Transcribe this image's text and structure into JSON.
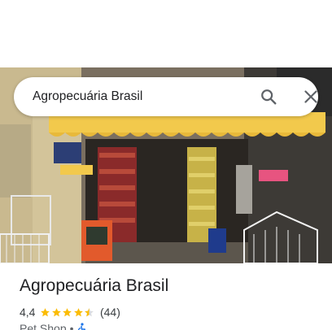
{
  "search": {
    "value": "Agropecuária Brasil"
  },
  "place": {
    "name": "Agropecuária Brasil",
    "rating": "4,4",
    "stars": 4.4,
    "review_count": "(44)",
    "category": "Pet Shop",
    "separator": "•"
  },
  "colors": {
    "star": "#fbbc04",
    "icon": "#5f6368",
    "accessibility_icon": "#1a73e8"
  },
  "icons": {
    "search": "search-icon",
    "close": "close-icon",
    "accessibility": "wheelchair-icon"
  }
}
